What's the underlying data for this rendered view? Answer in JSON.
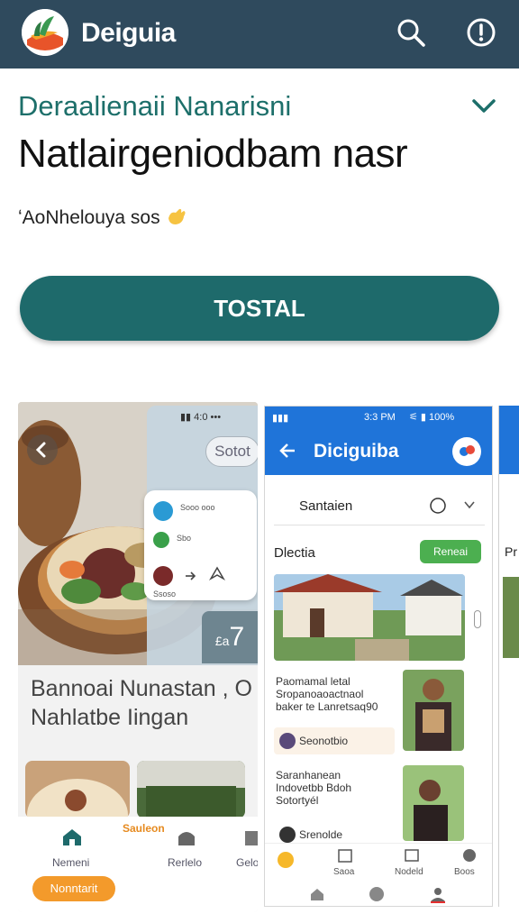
{
  "app": {
    "title": "Deiguia"
  },
  "colors": {
    "topbar": "#2f4a5d",
    "accent": "#1e6a6b",
    "subtitle": "#1d6f6a",
    "blue": "#1f74d9",
    "orange": "#f39a2b",
    "green": "#4caf50"
  },
  "header": {
    "subtitle": "Deraalienaii Nanarisni",
    "headline": "Natlairgeniodbam nasr",
    "tagline": "ʻAoNhelouya sos"
  },
  "cta": {
    "label": "TOSTAL"
  },
  "card1": {
    "status": "▮▮ 4:0 •••",
    "pill": "Sotot",
    "mini": {
      "row1": "Sooo ooo",
      "row2": "Sbo",
      "row3": "Ssoso"
    },
    "price_prefix": "£a",
    "price": "7",
    "caption_line1": "Bannoai Nunastan ,   O",
    "caption_line2": "Nahlatbe Iingan",
    "nav": {
      "home": "Nemeni",
      "center": "Rerlelo",
      "right": "Gelo",
      "popup": "Sauleon",
      "button": "Nonntarit"
    }
  },
  "card2": {
    "status": "3:3 PM",
    "title": "Diciguiba",
    "search_label": "Santaien",
    "section": "Dlectia",
    "badge": "Reneai",
    "item1": {
      "line1": "Paomamal letal",
      "line2": "Sropanoaoactnaol",
      "line3": "baker te Lanretsaq90"
    },
    "chip1": "Seonotbio",
    "item2": {
      "line1": "Saranhanean",
      "line2": "Indovetbb Bdoh",
      "line3": "Sotortyél"
    },
    "chip2": "Srenolde",
    "nav": {
      "a": "Saoa",
      "b": "Nodeld",
      "c": "Boos"
    }
  },
  "card3": {
    "peek": "Pr"
  }
}
